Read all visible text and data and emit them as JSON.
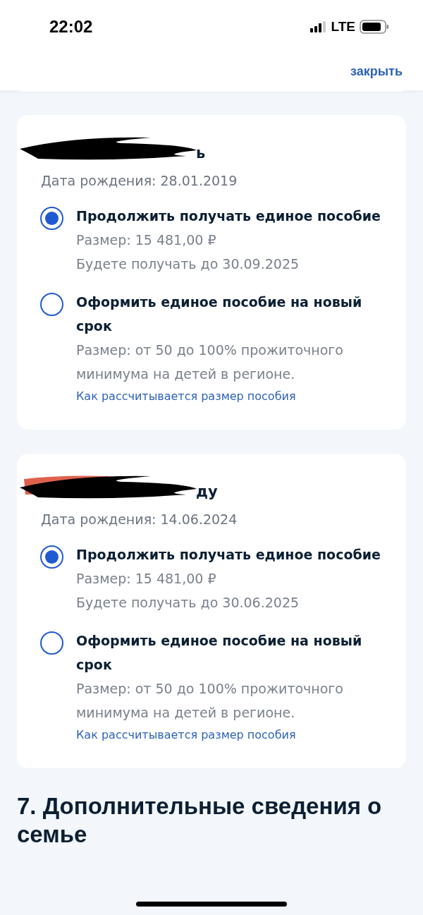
{
  "status_bar": {
    "time": "22:02",
    "network": "LTE"
  },
  "header": {
    "close_link": "закрыть"
  },
  "children": [
    {
      "name_visible": "ь",
      "birth_date": "Дата рождения: 28.01.2019",
      "options": [
        {
          "title": "Продолжить получать единое пособие",
          "selected": true,
          "lines": [
            "Размер: 15 481,00 ₽",
            "Будете получать до 30.09.2025"
          ]
        },
        {
          "title": "Оформить единое пособие на новый срок",
          "selected": false,
          "lines": [
            "Размер: от 50 до 100% прожиточного минимума на детей в регионе."
          ],
          "link": "Как рассчитывается размер пособия"
        }
      ]
    },
    {
      "name_visible": "ду",
      "birth_date": "Дата рождения: 14.06.2024",
      "options": [
        {
          "title": "Продолжить получать единое пособие",
          "selected": true,
          "lines": [
            "Размер: 15 481,00 ₽",
            "Будете получать до 30.06.2025"
          ]
        },
        {
          "title": "Оформить единое пособие на новый срок",
          "selected": false,
          "lines": [
            "Размер: от 50 до 100% прожиточного минимума на детей в регионе."
          ],
          "link": "Как рассчитывается размер пособия"
        }
      ]
    }
  ],
  "section_heading": "7. Дополнительные сведения о семье"
}
